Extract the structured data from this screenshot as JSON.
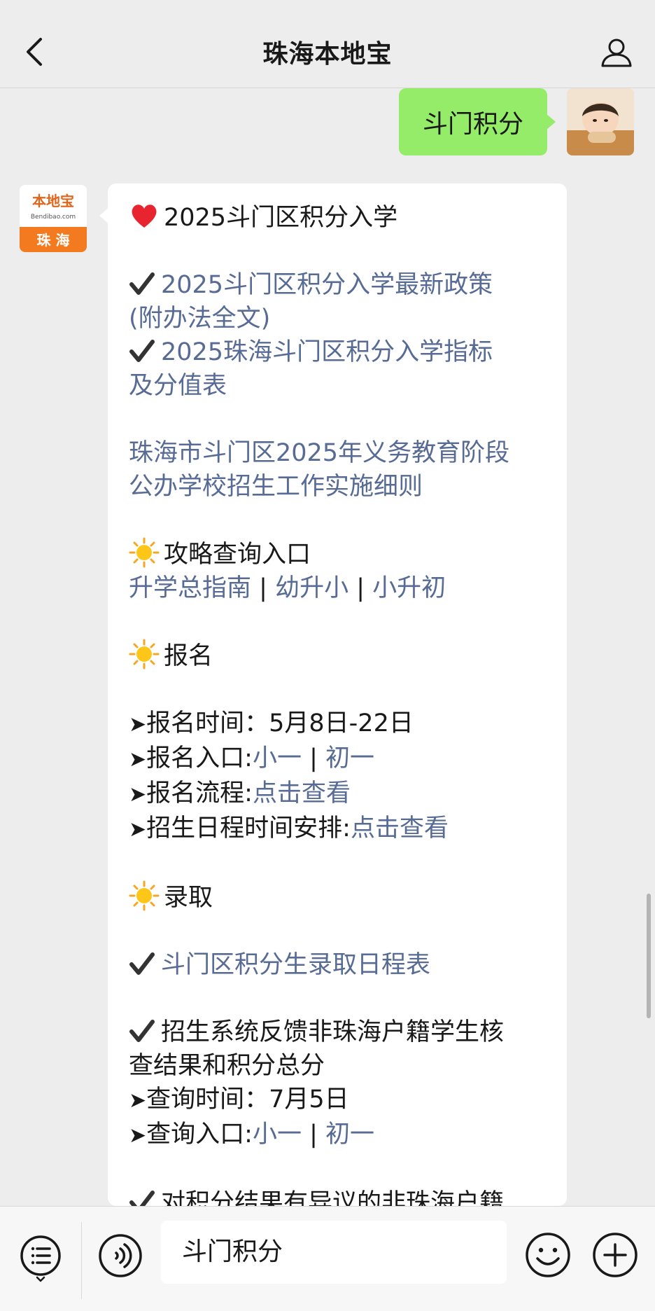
{
  "header": {
    "title": "珠海本地宝"
  },
  "outgoing": {
    "text": "斗门积分"
  },
  "incoming": {
    "avatar": {
      "top_text": "本地宝",
      "domain_text": "Bendibao.com",
      "city_text": "珠 海"
    },
    "l1": "2025斗门区积分入学",
    "l2": "2025斗门区积分入学最新政策",
    "l3": "(附办法全文)",
    "l4": "2025珠海斗门区积分入学指标",
    "l5": "及分值表",
    "l6": "珠海市斗门区2025年义务教育阶段",
    "l7": "公办学校招生工作实施细则",
    "l8": "攻略查询入口",
    "l9a": "升学总指南",
    "sep": " | ",
    "l9b": "幼升小",
    "l9c": "小升初",
    "l10": "报名",
    "arrow": "➤",
    "l11": "报名时间：5月8日-22日",
    "l12a": "报名入口:",
    "l12b": "小一",
    "l12c": "初一",
    "l13a": "报名流程:",
    "l13b": "点击查看",
    "l14a": "招生日程时间安排:",
    "l14b": "点击查看",
    "l15": "录取",
    "l16": "斗门区积分生录取日程表",
    "l17": "招生系统反馈非珠海户籍学生核",
    "l18": "查结果和积分总分",
    "l19": "查询时间：7月5日",
    "l20a": "查询入口:",
    "l20b": "小一",
    "l20c": "初一",
    "l21": "对积分结果有异议的非珠海户籍"
  },
  "input": {
    "value": "斗门积分"
  },
  "colors": {
    "link": "#576b95",
    "bubble_out": "#95ec69",
    "bg": "#ededed"
  }
}
